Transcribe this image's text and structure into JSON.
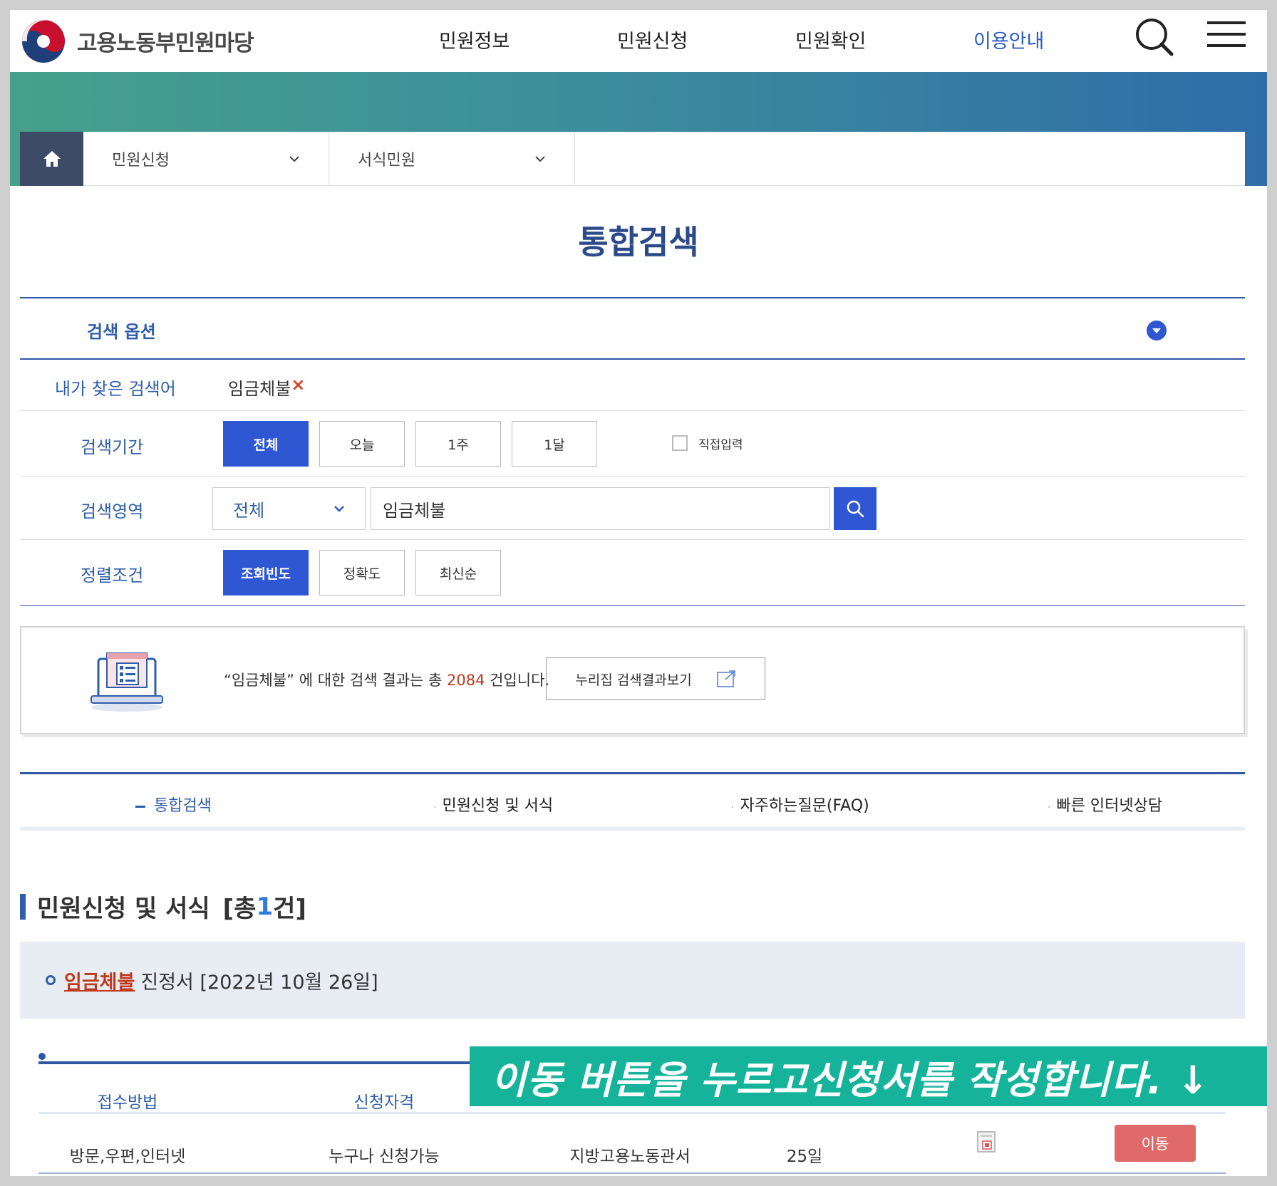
{
  "header": {
    "logo_text": "고용노동부민원마당",
    "nav": [
      "민원정보",
      "민원신청",
      "민원확인",
      "이용안내"
    ],
    "active_nav": "이용안내"
  },
  "breadcrumb": {
    "items": [
      "민원신청",
      "서식민원"
    ]
  },
  "page_title": "통합검색",
  "search": {
    "options_label": "검색 옵션",
    "my_keywords_label": "내가 찾은 검색어",
    "my_keyword": "임금체불",
    "remove_mark": "×",
    "period_label": "검색기간",
    "period_options": [
      "전체",
      "오늘",
      "1주",
      "1달"
    ],
    "period_selected": "전체",
    "direct_input_label": "직접입력",
    "area_label": "검색영역",
    "area_select_value": "전체",
    "query_value": "임금체불",
    "sort_label": "정렬조건",
    "sort_options": [
      "조회빈도",
      "정확도",
      "최신순"
    ],
    "sort_selected": "조회빈도"
  },
  "result_summary": {
    "text_before": "“임금체불” 에 대한 검색 결과는 총 ",
    "count": "2084",
    "text_after": " 건입니다.",
    "external_button": "누리집 검색결과보기"
  },
  "tabs": [
    "통합검색",
    "민원신청 및 서식",
    "자주하는질문(FAQ)",
    "빠른 인터넷상담"
  ],
  "active_tab": "통합검색",
  "section": {
    "title": "민원신청 및 서식",
    "count_prefix": "[총 ",
    "count": "1",
    "count_suffix": "건]"
  },
  "result_item": {
    "keyword": "임금체불",
    "title_rest": "진정서 [2022년 10월 26일]"
  },
  "detail_table": {
    "headers": [
      "접수방법",
      "신청자격"
    ],
    "row": [
      "방문,우편,인터넷",
      "누구나 신청가능",
      "지방고용노동관서",
      "25일"
    ],
    "move_button": "이동"
  },
  "caption": "이동 버튼을 누르고신청서를 작성합니다. ↓",
  "colors": {
    "primary_blue": "#2f57d4",
    "label_blue": "#2e5dab",
    "accent_red": "#c0391b",
    "move_button": "#e06a6a",
    "caption_bg": "#15b49a"
  }
}
